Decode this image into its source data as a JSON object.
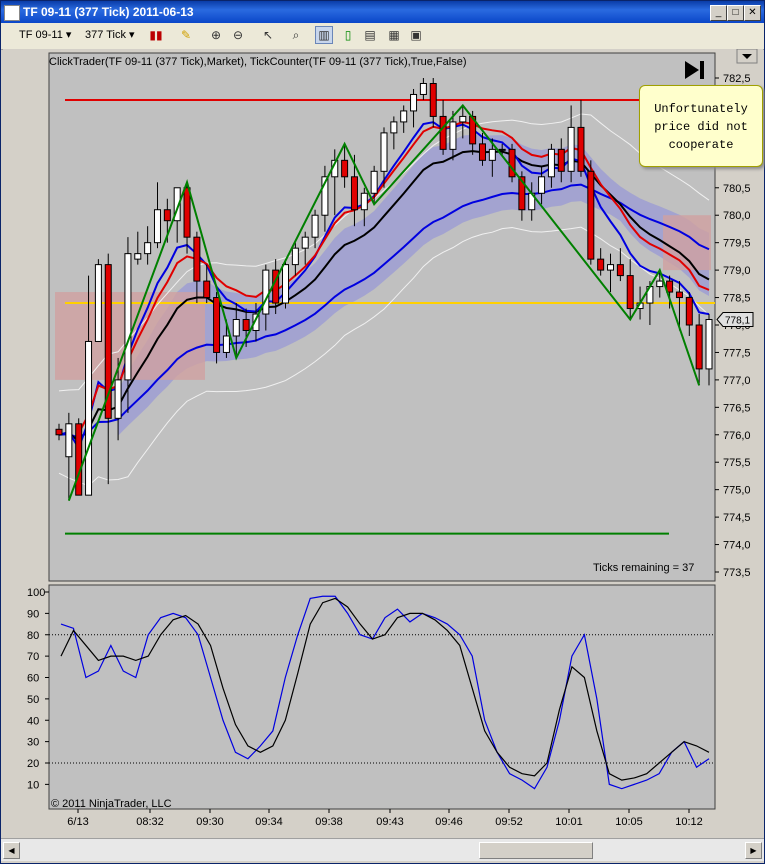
{
  "window": {
    "title": "TF 09-11 (377 Tick)  2011-06-13",
    "min_label": "_",
    "max_label": "□",
    "close_label": "✕"
  },
  "toolbar": {
    "instrument": "TF 09-11",
    "interval": "377 Tick",
    "icons": [
      "bar-style-icon",
      "pencil-icon",
      "zoom-in-icon",
      "zoom-out-icon",
      "cursor-icon",
      "magnifier-icon",
      "chart-style-icon",
      "candle-icon",
      "data-box-icon",
      "properties-icon",
      "layout-icon"
    ]
  },
  "chart_header": "ClickTrader(TF 09-11 (377 Tick),Market), TickCounter(TF 09-11 (377 Tick),True,False)",
  "ticks_remaining": "Ticks remaining = 37",
  "copyright": "© 2011 NinjaTrader, LLC",
  "callout": [
    "Unfortunately",
    "price did not",
    "cooperate"
  ],
  "last_price_label": "778,1",
  "colors": {
    "panel_bg": "#c0c0c0",
    "bull_candle": "#ffffff",
    "bear_candle": "#e00000",
    "zigzag": "#008000",
    "red_line": "#e00000",
    "yellow_line": "#ffd000",
    "green_line": "#008000",
    "blue_ma": "#0000e0",
    "black_ma": "#000000",
    "cloud": "#9a9ad6",
    "pink_cloud": "#d0a0a0"
  },
  "chart_data": [
    {
      "type": "candlestick",
      "ylim": [
        773.5,
        782.5
      ],
      "y_ticks": [
        "782,5",
        "782,0",
        "781,5",
        "781,0",
        "780,5",
        "780,0",
        "779,5",
        "779,0",
        "778,5",
        "778,0",
        "777,5",
        "777,0",
        "776,5",
        "776,0",
        "775,5",
        "775,0",
        "774,5",
        "774,0",
        "773,5"
      ],
      "x_ticks": [
        "6/13",
        "08:32",
        "09:30",
        "09:34",
        "09:38",
        "09:43",
        "09:46",
        "09:52",
        "10:01",
        "10:05",
        "10:12"
      ],
      "horizontal_lines": [
        {
          "name": "",
          "y": 782.1,
          "color": "red"
        },
        {
          "name": "",
          "y": 778.4,
          "color": "yellow"
        },
        {
          "name": "",
          "y": 774.2,
          "color": "green"
        }
      ],
      "candles": [
        [
          776.1,
          776.2,
          775.9,
          776.0
        ],
        [
          775.6,
          776.4,
          774.8,
          776.2
        ],
        [
          776.2,
          776.3,
          774.9,
          774.9
        ],
        [
          774.9,
          778.9,
          774.9,
          777.7
        ],
        [
          777.7,
          779.2,
          777.7,
          779.1
        ],
        [
          779.1,
          779.3,
          775.1,
          776.3
        ],
        [
          776.3,
          777.4,
          775.9,
          777.0
        ],
        [
          777.0,
          779.6,
          776.4,
          779.3
        ],
        [
          779.2,
          779.7,
          779.1,
          779.3
        ],
        [
          779.3,
          779.8,
          779.1,
          779.5
        ],
        [
          779.5,
          780.6,
          779.4,
          780.1
        ],
        [
          780.1,
          780.3,
          779.5,
          779.9
        ],
        [
          779.9,
          780.5,
          779.5,
          780.5
        ],
        [
          780.5,
          780.6,
          779.3,
          779.6
        ],
        [
          779.6,
          779.7,
          778.4,
          778.8
        ],
        [
          778.8,
          779.1,
          778.4,
          778.5
        ],
        [
          778.5,
          778.6,
          777.3,
          777.5
        ],
        [
          777.5,
          778.1,
          777.4,
          777.8
        ],
        [
          777.8,
          778.4,
          777.4,
          778.1
        ],
        [
          778.1,
          778.3,
          777.6,
          777.9
        ],
        [
          777.9,
          778.4,
          777.7,
          778.2
        ],
        [
          778.2,
          779.1,
          777.9,
          779.0
        ],
        [
          779.0,
          779.2,
          778.2,
          778.4
        ],
        [
          778.4,
          779.2,
          778.3,
          779.1
        ],
        [
          779.1,
          779.5,
          778.9,
          779.4
        ],
        [
          779.4,
          779.7,
          779.1,
          779.6
        ],
        [
          779.6,
          780.1,
          779.4,
          780.0
        ],
        [
          780.0,
          780.9,
          779.7,
          780.7
        ],
        [
          780.7,
          781.2,
          780.0,
          781.0
        ],
        [
          781.0,
          781.3,
          780.5,
          780.7
        ],
        [
          780.7,
          781.1,
          779.8,
          780.1
        ],
        [
          780.1,
          780.5,
          779.8,
          780.4
        ],
        [
          780.4,
          780.9,
          780.2,
          780.8
        ],
        [
          780.8,
          781.6,
          780.5,
          781.5
        ],
        [
          781.5,
          781.8,
          781.2,
          781.7
        ],
        [
          781.7,
          782.0,
          781.5,
          781.9
        ],
        [
          781.9,
          782.3,
          781.6,
          782.2
        ],
        [
          782.2,
          782.5,
          782.1,
          782.4
        ],
        [
          782.4,
          782.5,
          781.6,
          781.8
        ],
        [
          781.8,
          782.1,
          781.1,
          781.2
        ],
        [
          781.2,
          781.9,
          781.0,
          781.7
        ],
        [
          781.7,
          782.0,
          781.4,
          781.8
        ],
        [
          781.8,
          781.9,
          781.1,
          781.3
        ],
        [
          781.3,
          781.5,
          780.9,
          781.0
        ],
        [
          781.0,
          781.4,
          780.7,
          781.2
        ],
        [
          781.2,
          781.3,
          781.1,
          781.2
        ],
        [
          781.2,
          781.3,
          780.6,
          780.7
        ],
        [
          780.7,
          780.8,
          779.9,
          780.1
        ],
        [
          780.1,
          780.6,
          779.9,
          780.4
        ],
        [
          780.4,
          780.9,
          780.2,
          780.7
        ],
        [
          780.7,
          781.3,
          780.5,
          781.2
        ],
        [
          781.2,
          781.4,
          780.6,
          780.8
        ],
        [
          780.8,
          782.0,
          780.6,
          781.6
        ],
        [
          781.6,
          782.1,
          780.7,
          780.8
        ],
        [
          780.8,
          781.0,
          779.1,
          779.2
        ],
        [
          779.2,
          779.4,
          778.9,
          779.0
        ],
        [
          779.0,
          779.3,
          778.6,
          779.1
        ],
        [
          779.1,
          779.4,
          778.8,
          778.9
        ],
        [
          778.9,
          779.2,
          778.1,
          778.3
        ],
        [
          778.3,
          778.7,
          778.1,
          778.4
        ],
        [
          778.4,
          778.8,
          778.0,
          778.7
        ],
        [
          778.7,
          779.0,
          778.5,
          778.8
        ],
        [
          778.8,
          778.9,
          778.3,
          778.6
        ],
        [
          778.6,
          778.8,
          777.9,
          778.5
        ],
        [
          778.5,
          778.6,
          777.8,
          778.0
        ],
        [
          778.0,
          778.2,
          776.9,
          777.2
        ],
        [
          777.2,
          778.2,
          776.9,
          778.1
        ]
      ]
    },
    {
      "type": "line",
      "ylim": [
        4,
        104
      ],
      "y_ticks": [
        "100",
        "90",
        "80",
        "70",
        "60",
        "50",
        "40",
        "30",
        "20",
        "10"
      ],
      "reference_lines": [
        80,
        20
      ],
      "series": [
        {
          "name": "",
          "color": "blue",
          "values": [
            85,
            83,
            60,
            63,
            75,
            63,
            60,
            80,
            88,
            90,
            88,
            80,
            60,
            40,
            25,
            22,
            28,
            35,
            60,
            80,
            97,
            98,
            98,
            90,
            80,
            78,
            88,
            92,
            86,
            90,
            88,
            85,
            80,
            70,
            40,
            25,
            15,
            12,
            8,
            18,
            40,
            70,
            80,
            50,
            10,
            8,
            10,
            12,
            15,
            25,
            30,
            18,
            22
          ]
        },
        {
          "name": "",
          "color": "black",
          "values": [
            70,
            82,
            75,
            68,
            70,
            70,
            68,
            70,
            80,
            87,
            89,
            85,
            75,
            55,
            38,
            28,
            25,
            28,
            40,
            62,
            85,
            95,
            97,
            93,
            85,
            78,
            80,
            88,
            90,
            90,
            87,
            82,
            75,
            55,
            35,
            25,
            18,
            15,
            14,
            20,
            45,
            65,
            60,
            35,
            15,
            12,
            13,
            15,
            20,
            25,
            30,
            28,
            25
          ]
        }
      ]
    }
  ]
}
